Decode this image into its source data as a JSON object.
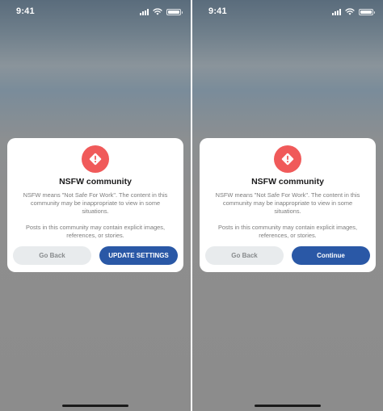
{
  "screens": [
    {
      "status_bar": {
        "time": "9:41"
      },
      "dialog": {
        "title": "NSFW community",
        "body_1": "NSFW means \"Not Safe For Work\". The content in this community may be inappropriate to view in some situations.",
        "body_2": "Posts in this community may contain explicit images, references, or stories.",
        "secondary_button": "Go Back",
        "primary_button": "UPDATE SETTINGS"
      }
    },
    {
      "status_bar": {
        "time": "9:41"
      },
      "dialog": {
        "title": "NSFW community",
        "body_1": "NSFW means \"Not Safe For Work\". The content in this community may be inappropriate to view in some situations.",
        "body_2": "Posts in this community may contain explicit images, references, or stories.",
        "secondary_button": "Go Back",
        "primary_button": "Continue"
      }
    }
  ],
  "colors": {
    "alert_icon": "#f05a5a",
    "primary_button": "#2a58a6",
    "secondary_button": "#e8ebed"
  },
  "icons": {
    "status": [
      "signal-icon",
      "wifi-icon",
      "battery-icon"
    ],
    "dialog": "alert-icon"
  }
}
